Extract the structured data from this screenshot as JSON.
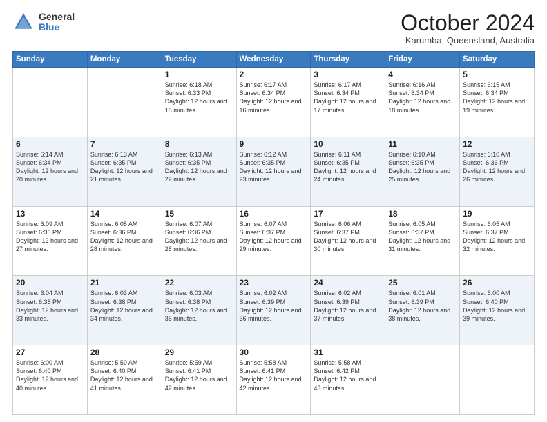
{
  "header": {
    "logo_general": "General",
    "logo_blue": "Blue",
    "month_title": "October 2024",
    "location": "Karumba, Queensland, Australia"
  },
  "days_of_week": [
    "Sunday",
    "Monday",
    "Tuesday",
    "Wednesday",
    "Thursday",
    "Friday",
    "Saturday"
  ],
  "weeks": [
    [
      {
        "day": "",
        "info": ""
      },
      {
        "day": "",
        "info": ""
      },
      {
        "day": "1",
        "info": "Sunrise: 6:18 AM\nSunset: 6:33 PM\nDaylight: 12 hours and 15 minutes."
      },
      {
        "day": "2",
        "info": "Sunrise: 6:17 AM\nSunset: 6:34 PM\nDaylight: 12 hours and 16 minutes."
      },
      {
        "day": "3",
        "info": "Sunrise: 6:17 AM\nSunset: 6:34 PM\nDaylight: 12 hours and 17 minutes."
      },
      {
        "day": "4",
        "info": "Sunrise: 6:16 AM\nSunset: 6:34 PM\nDaylight: 12 hours and 18 minutes."
      },
      {
        "day": "5",
        "info": "Sunrise: 6:15 AM\nSunset: 6:34 PM\nDaylight: 12 hours and 19 minutes."
      }
    ],
    [
      {
        "day": "6",
        "info": "Sunrise: 6:14 AM\nSunset: 6:34 PM\nDaylight: 12 hours and 20 minutes."
      },
      {
        "day": "7",
        "info": "Sunrise: 6:13 AM\nSunset: 6:35 PM\nDaylight: 12 hours and 21 minutes."
      },
      {
        "day": "8",
        "info": "Sunrise: 6:13 AM\nSunset: 6:35 PM\nDaylight: 12 hours and 22 minutes."
      },
      {
        "day": "9",
        "info": "Sunrise: 6:12 AM\nSunset: 6:35 PM\nDaylight: 12 hours and 23 minutes."
      },
      {
        "day": "10",
        "info": "Sunrise: 6:11 AM\nSunset: 6:35 PM\nDaylight: 12 hours and 24 minutes."
      },
      {
        "day": "11",
        "info": "Sunrise: 6:10 AM\nSunset: 6:35 PM\nDaylight: 12 hours and 25 minutes."
      },
      {
        "day": "12",
        "info": "Sunrise: 6:10 AM\nSunset: 6:36 PM\nDaylight: 12 hours and 26 minutes."
      }
    ],
    [
      {
        "day": "13",
        "info": "Sunrise: 6:09 AM\nSunset: 6:36 PM\nDaylight: 12 hours and 27 minutes."
      },
      {
        "day": "14",
        "info": "Sunrise: 6:08 AM\nSunset: 6:36 PM\nDaylight: 12 hours and 28 minutes."
      },
      {
        "day": "15",
        "info": "Sunrise: 6:07 AM\nSunset: 6:36 PM\nDaylight: 12 hours and 28 minutes."
      },
      {
        "day": "16",
        "info": "Sunrise: 6:07 AM\nSunset: 6:37 PM\nDaylight: 12 hours and 29 minutes."
      },
      {
        "day": "17",
        "info": "Sunrise: 6:06 AM\nSunset: 6:37 PM\nDaylight: 12 hours and 30 minutes."
      },
      {
        "day": "18",
        "info": "Sunrise: 6:05 AM\nSunset: 6:37 PM\nDaylight: 12 hours and 31 minutes."
      },
      {
        "day": "19",
        "info": "Sunrise: 6:05 AM\nSunset: 6:37 PM\nDaylight: 12 hours and 32 minutes."
      }
    ],
    [
      {
        "day": "20",
        "info": "Sunrise: 6:04 AM\nSunset: 6:38 PM\nDaylight: 12 hours and 33 minutes."
      },
      {
        "day": "21",
        "info": "Sunrise: 6:03 AM\nSunset: 6:38 PM\nDaylight: 12 hours and 34 minutes."
      },
      {
        "day": "22",
        "info": "Sunrise: 6:03 AM\nSunset: 6:38 PM\nDaylight: 12 hours and 35 minutes."
      },
      {
        "day": "23",
        "info": "Sunrise: 6:02 AM\nSunset: 6:39 PM\nDaylight: 12 hours and 36 minutes."
      },
      {
        "day": "24",
        "info": "Sunrise: 6:02 AM\nSunset: 6:39 PM\nDaylight: 12 hours and 37 minutes."
      },
      {
        "day": "25",
        "info": "Sunrise: 6:01 AM\nSunset: 6:39 PM\nDaylight: 12 hours and 38 minutes."
      },
      {
        "day": "26",
        "info": "Sunrise: 6:00 AM\nSunset: 6:40 PM\nDaylight: 12 hours and 39 minutes."
      }
    ],
    [
      {
        "day": "27",
        "info": "Sunrise: 6:00 AM\nSunset: 6:40 PM\nDaylight: 12 hours and 40 minutes."
      },
      {
        "day": "28",
        "info": "Sunrise: 5:59 AM\nSunset: 6:40 PM\nDaylight: 12 hours and 41 minutes."
      },
      {
        "day": "29",
        "info": "Sunrise: 5:59 AM\nSunset: 6:41 PM\nDaylight: 12 hours and 42 minutes."
      },
      {
        "day": "30",
        "info": "Sunrise: 5:58 AM\nSunset: 6:41 PM\nDaylight: 12 hours and 42 minutes."
      },
      {
        "day": "31",
        "info": "Sunrise: 5:58 AM\nSunset: 6:42 PM\nDaylight: 12 hours and 43 minutes."
      },
      {
        "day": "",
        "info": ""
      },
      {
        "day": "",
        "info": ""
      }
    ]
  ]
}
